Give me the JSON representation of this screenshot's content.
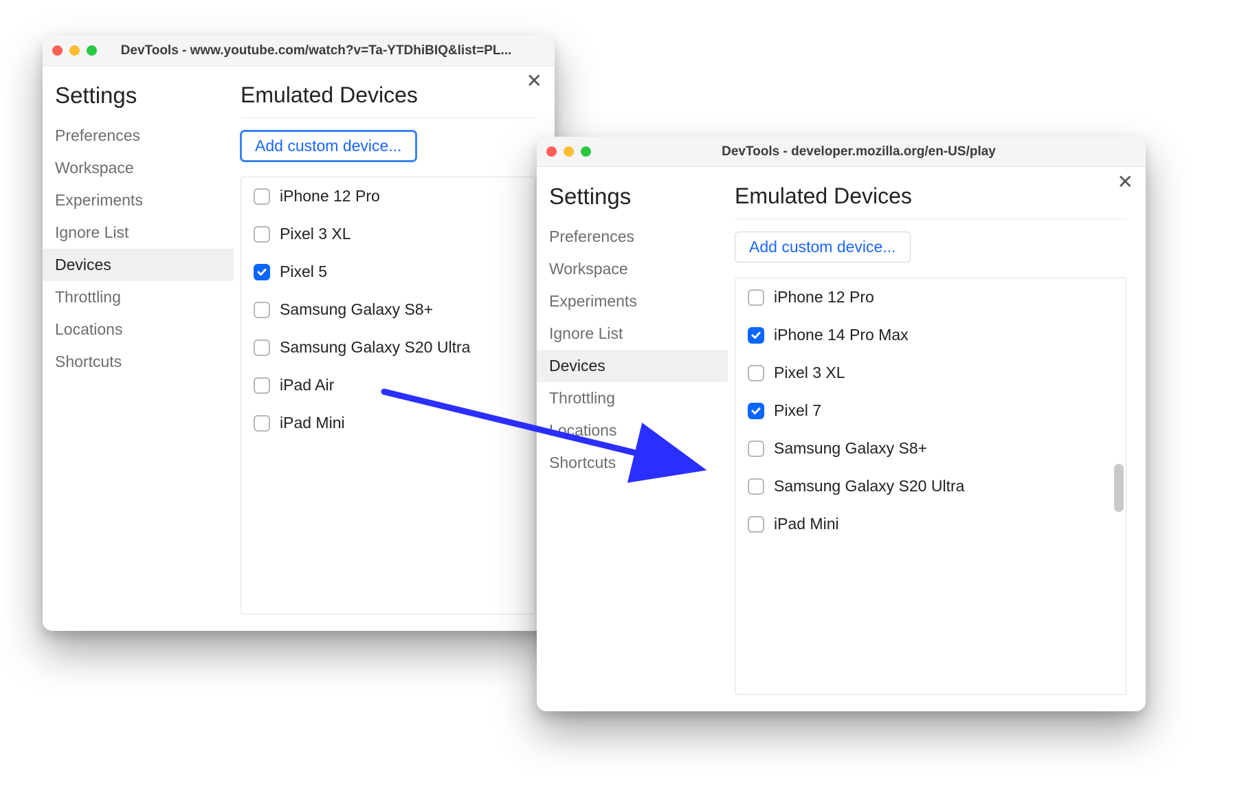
{
  "arrow_color": "#2a2fff",
  "windows": {
    "back": {
      "title": "DevTools - www.youtube.com/watch?v=Ta-YTDhiBIQ&list=PL...",
      "settings_label": "Settings",
      "section_heading": "Emulated Devices",
      "add_button": "Add custom device...",
      "add_button_focused": true,
      "sidebar": [
        {
          "label": "Preferences",
          "active": false
        },
        {
          "label": "Workspace",
          "active": false
        },
        {
          "label": "Experiments",
          "active": false
        },
        {
          "label": "Ignore List",
          "active": false
        },
        {
          "label": "Devices",
          "active": true
        },
        {
          "label": "Throttling",
          "active": false
        },
        {
          "label": "Locations",
          "active": false
        },
        {
          "label": "Shortcuts",
          "active": false
        }
      ],
      "devices": [
        {
          "label": "iPhone 12 Pro",
          "checked": false
        },
        {
          "label": "Pixel 3 XL",
          "checked": false
        },
        {
          "label": "Pixel 5",
          "checked": true
        },
        {
          "label": "Samsung Galaxy S8+",
          "checked": false
        },
        {
          "label": "Samsung Galaxy S20 Ultra",
          "checked": false
        },
        {
          "label": "iPad Air",
          "checked": false
        },
        {
          "label": "iPad Mini",
          "checked": false
        }
      ]
    },
    "front": {
      "title": "DevTools - developer.mozilla.org/en-US/play",
      "settings_label": "Settings",
      "section_heading": "Emulated Devices",
      "add_button": "Add custom device...",
      "add_button_focused": false,
      "sidebar": [
        {
          "label": "Preferences",
          "active": false
        },
        {
          "label": "Workspace",
          "active": false
        },
        {
          "label": "Experiments",
          "active": false
        },
        {
          "label": "Ignore List",
          "active": false
        },
        {
          "label": "Devices",
          "active": true
        },
        {
          "label": "Throttling",
          "active": false
        },
        {
          "label": "Locations",
          "active": false
        },
        {
          "label": "Shortcuts",
          "active": false
        }
      ],
      "devices": [
        {
          "label": "iPhone 12 Pro",
          "checked": false
        },
        {
          "label": "iPhone 14 Pro Max",
          "checked": true
        },
        {
          "label": "Pixel 3 XL",
          "checked": false
        },
        {
          "label": "Pixel 7",
          "checked": true
        },
        {
          "label": "Samsung Galaxy S8+",
          "checked": false
        },
        {
          "label": "Samsung Galaxy S20 Ultra",
          "checked": false
        },
        {
          "label": "iPad Mini",
          "checked": false
        }
      ]
    }
  }
}
